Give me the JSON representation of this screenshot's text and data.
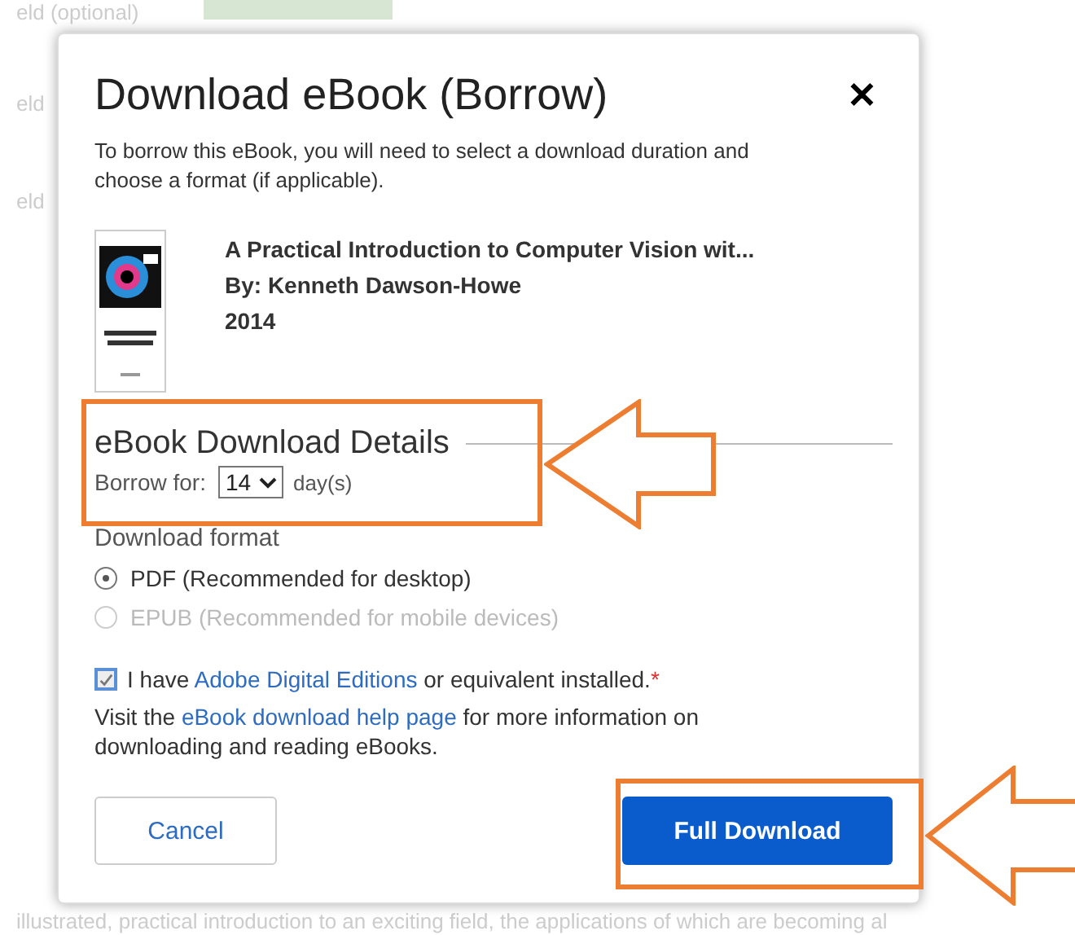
{
  "background": {
    "field_label": "eld (optional)",
    "row_labels": [
      "eld",
      "eld"
    ],
    "text_line": "illustrated, practical introduction to an exciting field, the applications of which are becoming al"
  },
  "dialog": {
    "title": "Download eBook (Borrow)",
    "close": "✕",
    "intro": "To borrow this eBook, you will need to select a download duration and choose a format (if applicable).",
    "book": {
      "title": "A Practical Introduction to Computer Vision wit...",
      "author": "By: Kenneth Dawson-Howe",
      "year": "2014"
    },
    "details": {
      "heading": "eBook Download Details",
      "borrow_label": "Borrow for:",
      "borrow_value": "14",
      "borrow_unit": "day(s)"
    },
    "format": {
      "label": "Download format",
      "options": [
        {
          "name": "PDF",
          "note": "(Recommended for desktop)",
          "selected": true,
          "disabled": false
        },
        {
          "name": "EPUB",
          "note": "(Recommended for mobile devices)",
          "selected": false,
          "disabled": true
        }
      ]
    },
    "agreement": {
      "checked": true,
      "before": "I have ",
      "link": "Adobe Digital Editions",
      "after": " or equivalent installed.",
      "required": "*"
    },
    "help": {
      "before": "Visit the ",
      "link": "eBook download help page",
      "after": " for more information on downloading and reading eBooks."
    },
    "buttons": [
      {
        "label": "Cancel",
        "kind": "secondary"
      },
      {
        "label": "Full Download",
        "kind": "primary"
      }
    ]
  }
}
